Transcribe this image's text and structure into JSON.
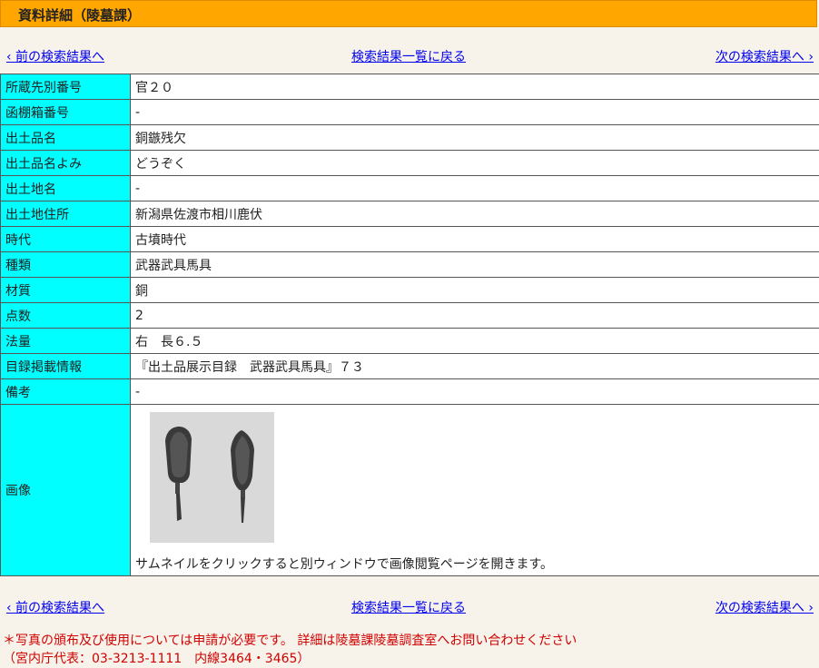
{
  "header": {
    "title": "資料詳細（陵墓課）"
  },
  "nav": {
    "prev_label": "‹ 前の検索結果へ",
    "list_label": "検索結果一覧に戻る",
    "next_label": "次の検索結果へ ›"
  },
  "details": [
    {
      "label": "所蔵先別番号",
      "value": "官２０"
    },
    {
      "label": "函棚箱番号",
      "value": "-"
    },
    {
      "label": "出土品名",
      "value": "銅鏃残欠"
    },
    {
      "label": "出土品名よみ",
      "value": "どうぞく"
    },
    {
      "label": "出土地名",
      "value": "-"
    },
    {
      "label": "出土地住所",
      "value": "新潟県佐渡市相川鹿伏"
    },
    {
      "label": "時代",
      "value": "古墳時代"
    },
    {
      "label": "種類",
      "value": "武器武具馬具"
    },
    {
      "label": "材質",
      "value": "銅"
    },
    {
      "label": "点数",
      "value": "2"
    },
    {
      "label": "法量",
      "value": "右　長６.５"
    },
    {
      "label": "目録掲載情報",
      "value": "『出土品展示目録　武器武具馬具』７３"
    },
    {
      "label": "備考",
      "value": "-"
    }
  ],
  "image_section": {
    "label": "画像",
    "note": "サムネイルをクリックすると別ウィンドウで画像閲覧ページを開きます。"
  },
  "footer": {
    "notice_line1": "＊写真の頒布及び使用については申請が必要です。 詳細は陵墓課陵墓調査室へお問い合わせください",
    "notice_line2": "（宮内庁代表：03-3213-1111　内線3464・3465）"
  },
  "colors": {
    "title_bar": "#ffa600",
    "label_cell": "#00ffff",
    "page_bg": "#f7f3ea",
    "link": "#0000ee",
    "notice": "#d00000"
  }
}
